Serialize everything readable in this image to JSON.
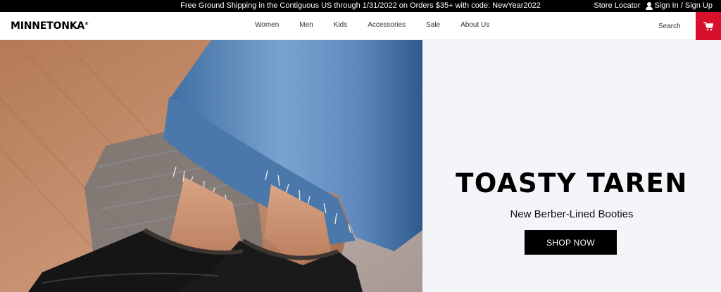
{
  "promo": {
    "text": "Free Ground Shipping in the Contiguous US through 1/31/2022 on Orders $35+ with code: NewYear2022"
  },
  "utility": {
    "store_locator": "Store Locator",
    "sign_in": "Sign In / Sign Up",
    "user_icon": "user-icon"
  },
  "header": {
    "logo": "MINNETONKA",
    "logo_mark": "®",
    "nav": [
      "Women",
      "Men",
      "Kids",
      "Accessories",
      "Sale",
      "About Us"
    ],
    "search": "Search",
    "cart_icon": "shopping-cart-icon"
  },
  "hero": {
    "title": "TOASTY TAREN",
    "subtitle": "New Berber-Lined Booties",
    "cta": "SHOP NOW"
  },
  "colors": {
    "promo_bg": "#000000",
    "cart_bg": "#d7102c",
    "hero_panel_bg": "#f4f5f9",
    "cta_bg": "#000000"
  }
}
